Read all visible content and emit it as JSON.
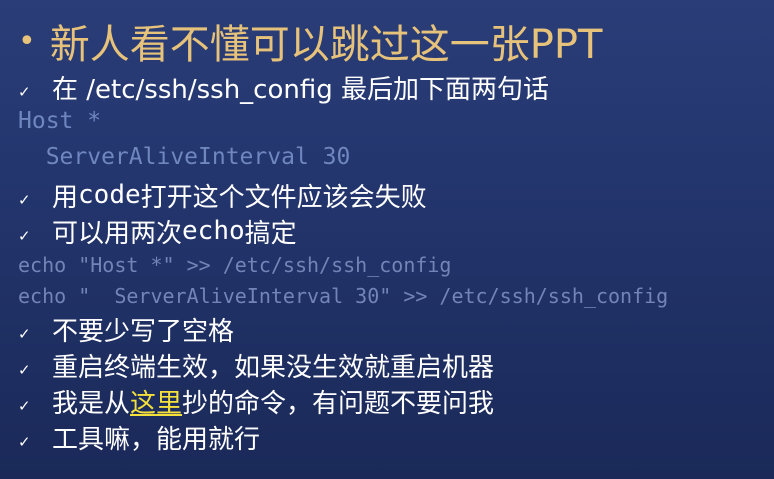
{
  "slide": {
    "title": "新人看不懂可以跳过这一张PPT",
    "title_bullet": "•",
    "check_glyph": "✓",
    "item_1": {
      "text_before": "在 /etc/ssh/ssh_config 最后加下面两句话"
    },
    "config_line_1": "Host *",
    "config_line_2": "  ServerAliveInterval 30",
    "item_2": {
      "text_a": "用 ",
      "code": "code",
      "text_b": " 打开这个文件应该会失败"
    },
    "item_3": {
      "text_a": "可以用两次 ",
      "code": "echo",
      "text_b": " 搞定"
    },
    "echo_line_1": "echo \"Host *\" >> /etc/ssh/ssh_config",
    "echo_line_2": "echo \"  ServerAliveInterval 30\" >> /etc/ssh/ssh_config",
    "item_4": "不要少写了空格",
    "item_5": "重启终端生效，如果没生效就重启机器",
    "item_6": {
      "text_a": "我是从",
      "link": "这里",
      "text_b": "抄的命令，有问题不要问我"
    },
    "item_7": "工具嘛，能用就行"
  },
  "colors": {
    "title": "#e6c27a",
    "body_text": "#ffffff",
    "code_text": "#6f86bf",
    "link": "#f3e03a",
    "background_top": "#2a3d78",
    "background_bottom": "#1a2958"
  }
}
